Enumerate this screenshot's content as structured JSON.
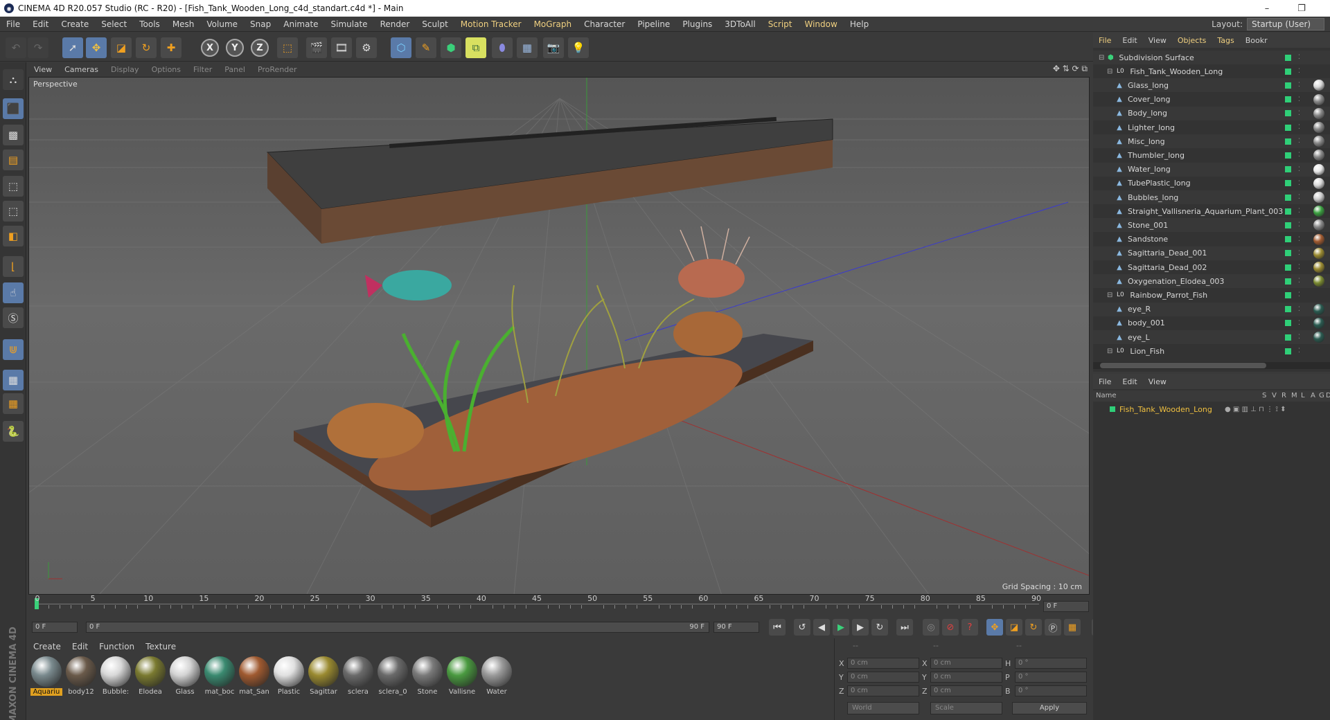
{
  "window": {
    "title": "CINEMA 4D R20.057 Studio (RC - R20) - [Fish_Tank_Wooden_Long_c4d_standart.c4d *] - Main",
    "min": "–",
    "max": "❐"
  },
  "menu": {
    "items": [
      "File",
      "Edit",
      "Create",
      "Select",
      "Tools",
      "Mesh",
      "Volume",
      "Snap",
      "Animate",
      "Simulate",
      "Render",
      "Sculpt",
      "Motion Tracker",
      "MoGraph",
      "Character",
      "Pipeline",
      "Plugins",
      "3DToAll",
      "Script",
      "Window",
      "Help"
    ],
    "layout_label": "Layout:",
    "layout_value": "Startup (User)"
  },
  "viewport": {
    "menu": [
      "View",
      "Cameras",
      "Display",
      "Options",
      "Filter",
      "Panel",
      "ProRender"
    ],
    "label": "Perspective",
    "grid_spacing": "Grid Spacing : 10 cm"
  },
  "timeline": {
    "ticks": [
      "0",
      "5",
      "10",
      "15",
      "20",
      "25",
      "30",
      "35",
      "40",
      "45",
      "50",
      "55",
      "60",
      "65",
      "70",
      "75",
      "80",
      "85",
      "90"
    ],
    "current_frame": "0 F",
    "start_field": "0 F",
    "range_start": "0 F",
    "range_end": "90 F",
    "end_field": "90 F"
  },
  "materials": {
    "menu": [
      "Create",
      "Edit",
      "Function",
      "Texture"
    ],
    "items": [
      {
        "name": "Aquariu",
        "color": "#7a8a8e"
      },
      {
        "name": "body12",
        "color": "#6a5a4a"
      },
      {
        "name": "Bubble:",
        "color": "#d8d8d8"
      },
      {
        "name": "Elodea",
        "color": "#7a7a30"
      },
      {
        "name": "Glass",
        "color": "#d4d4d4"
      },
      {
        "name": "mat_boc",
        "color": "#3a8a70"
      },
      {
        "name": "mat_San",
        "color": "#a05a30"
      },
      {
        "name": "Plastic",
        "color": "#e0e0e0"
      },
      {
        "name": "Sagittar",
        "color": "#9a8a30"
      },
      {
        "name": "sclera",
        "color": "#6a6a6a"
      },
      {
        "name": "sclera_0",
        "color": "#6a6a6a"
      },
      {
        "name": "Stone",
        "color": "#7a7a7a"
      },
      {
        "name": "Vallisne",
        "color": "#4a9a40"
      },
      {
        "name": "Water",
        "color": "#9a9a9a"
      }
    ]
  },
  "coords": {
    "headers": [
      "--",
      "--",
      "--"
    ],
    "rows": [
      {
        "a": "X",
        "av": "0 cm",
        "b": "X",
        "bv": "0 cm",
        "c": "H",
        "cv": "0 °"
      },
      {
        "a": "Y",
        "av": "0 cm",
        "b": "Y",
        "bv": "0 cm",
        "c": "P",
        "cv": "0 °"
      },
      {
        "a": "Z",
        "av": "0 cm",
        "b": "Z",
        "bv": "0 cm",
        "c": "B",
        "cv": "0 °"
      }
    ],
    "space": "World",
    "mode": "Scale",
    "apply": "Apply"
  },
  "objects": {
    "menu": [
      "File",
      "Edit",
      "View",
      "Objects",
      "Tags",
      "Bookr"
    ],
    "tree": [
      {
        "name": "Subdivision Surface",
        "indent": 0,
        "icon": "subdivision-icon",
        "tag": ""
      },
      {
        "name": "Fish_Tank_Wooden_Long",
        "indent": 1,
        "icon": "null-icon",
        "tag": ""
      },
      {
        "name": "Glass_long",
        "indent": 2,
        "icon": "polygon-icon",
        "tag": "#d8d8d8"
      },
      {
        "name": "Cover_long",
        "indent": 2,
        "icon": "polygon-icon",
        "tag": "#888888"
      },
      {
        "name": "Body_long",
        "indent": 2,
        "icon": "polygon-icon",
        "tag": "#888888"
      },
      {
        "name": "Lighter_long",
        "indent": 2,
        "icon": "polygon-icon",
        "tag": "#888888"
      },
      {
        "name": "Misc_long",
        "indent": 2,
        "icon": "polygon-icon",
        "tag": "#888888"
      },
      {
        "name": "Thumbler_long",
        "indent": 2,
        "icon": "polygon-icon",
        "tag": "#888888"
      },
      {
        "name": "Water_long",
        "indent": 2,
        "icon": "polygon-icon",
        "tag": "#e8e8e8"
      },
      {
        "name": "TubePlastic_long",
        "indent": 2,
        "icon": "polygon-icon",
        "tag": "#d8d8d8"
      },
      {
        "name": "Bubbles_long",
        "indent": 2,
        "icon": "polygon-icon",
        "tag": "#cccccc"
      },
      {
        "name": "Straight_Vallisneria_Aquarium_Plant_003",
        "indent": 2,
        "icon": "polygon-icon",
        "tag": "#3aa040"
      },
      {
        "name": "Stone_001",
        "indent": 2,
        "icon": "polygon-icon",
        "tag": "#888888"
      },
      {
        "name": "Sandstone",
        "indent": 2,
        "icon": "polygon-icon",
        "tag": "#a05a30"
      },
      {
        "name": "Sagittaria_Dead_001",
        "indent": 2,
        "icon": "polygon-icon",
        "tag": "#9a8a30"
      },
      {
        "name": "Sagittaria_Dead_002",
        "indent": 2,
        "icon": "polygon-icon",
        "tag": "#9a8a30"
      },
      {
        "name": "Oxygenation_Elodea_003",
        "indent": 2,
        "icon": "polygon-icon",
        "tag": "#7a8a30"
      },
      {
        "name": "Rainbow_Parrot_Fish",
        "indent": 1,
        "icon": "null-icon",
        "tag": ""
      },
      {
        "name": "eye_R",
        "indent": 2,
        "icon": "polygon-icon",
        "tag": "#2a5a50"
      },
      {
        "name": "body_001",
        "indent": 2,
        "icon": "polygon-icon",
        "tag": "#2a5a50"
      },
      {
        "name": "eye_L",
        "indent": 2,
        "icon": "polygon-icon",
        "tag": "#2a5a50"
      },
      {
        "name": "Lion_Fish",
        "indent": 1,
        "icon": "null-icon",
        "tag": ""
      }
    ]
  },
  "attributes": {
    "menu": [
      "File",
      "Edit",
      "View"
    ],
    "columns": [
      "Name",
      "S",
      "V",
      "R",
      "M",
      "L",
      "A",
      "G",
      "D"
    ],
    "row": "Fish_Tank_Wooden_Long"
  },
  "brand": "MAXON CINEMA 4D",
  "colors": {
    "accent": "#5a7aa8",
    "active_tag": "#2fcf78",
    "selection": "#e0a020"
  }
}
